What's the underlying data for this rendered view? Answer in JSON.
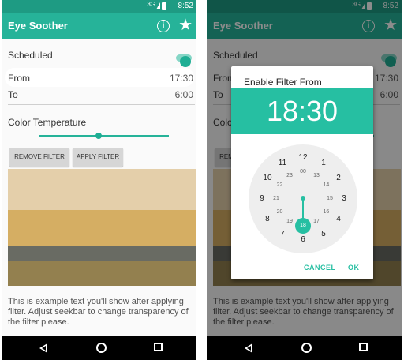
{
  "status_bar": {
    "signal": "3G",
    "time": "8:52"
  },
  "app": {
    "title": "Eye Soother"
  },
  "settings": {
    "scheduled_label": "Scheduled",
    "scheduled_on": true,
    "from_label": "From",
    "from_value": "17:30",
    "to_label": "To",
    "to_value": "6:00",
    "color_temp_label": "Color Temperature",
    "color_temp_position": 0.46,
    "remove_filter_label": "REMOVE FILTER",
    "apply_filter_label": "APPLY FILTER",
    "example_text": "This is example text you'll show after applying filter. Adjust seekbar to change transparency of the filter please."
  },
  "dialog": {
    "title": "Enable Filter From",
    "time": "18:30",
    "outer_numbers": [
      "12",
      "1",
      "2",
      "3",
      "4",
      "5",
      "6",
      "7",
      "8",
      "9",
      "10",
      "11"
    ],
    "inner_numbers": [
      "00",
      "13",
      "14",
      "15",
      "16",
      "17",
      "18",
      "19",
      "20",
      "21",
      "22",
      "23"
    ],
    "selected_hour": "18",
    "cancel_label": "CANCEL",
    "ok_label": "OK"
  },
  "colors": {
    "accent": "#26bfa2",
    "app_bar": "#26b399",
    "status_bar": "#1e9b83"
  }
}
